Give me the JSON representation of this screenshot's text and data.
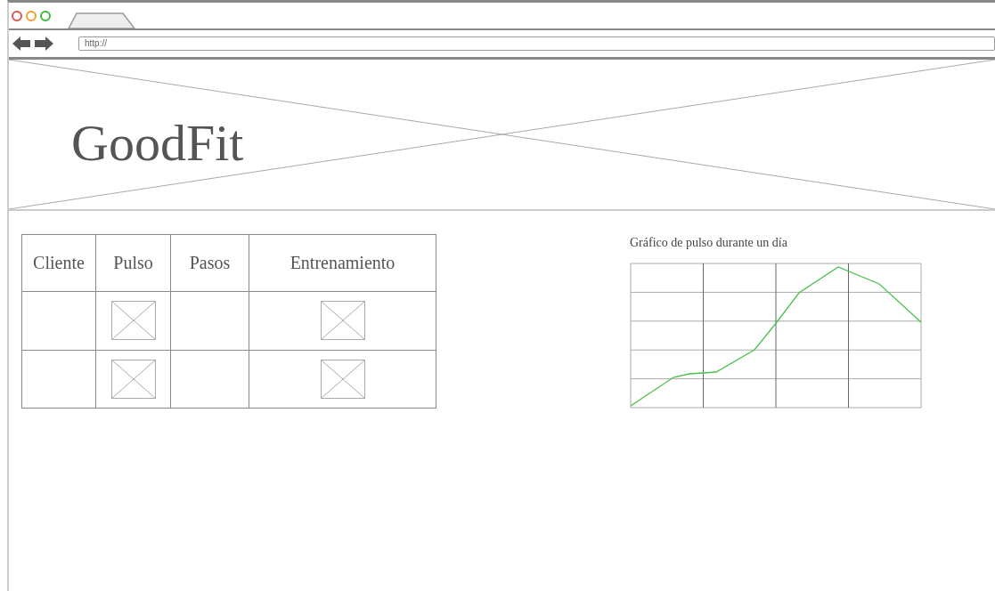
{
  "browser": {
    "address": "http://"
  },
  "banner": {
    "title": "GoodFit"
  },
  "table": {
    "columns": [
      "Cliente",
      "Pulso",
      "Pasos",
      "Entrenamiento"
    ],
    "rows": [
      {
        "cells": [
          {
            "kind": "empty"
          },
          {
            "kind": "image"
          },
          {
            "kind": "empty"
          },
          {
            "kind": "image"
          }
        ]
      },
      {
        "cells": [
          {
            "kind": "empty"
          },
          {
            "kind": "image"
          },
          {
            "kind": "empty"
          },
          {
            "kind": "image"
          }
        ]
      }
    ]
  },
  "chart": {
    "title": "Gráfico de pulso durante un día"
  }
}
